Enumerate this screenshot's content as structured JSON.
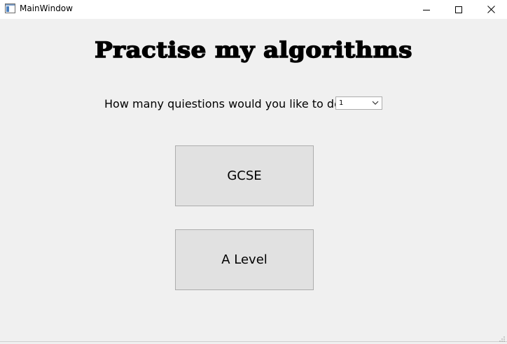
{
  "window": {
    "title": "MainWindow",
    "icons": {
      "app": "app-window-icon",
      "minimize": "minimize-icon",
      "maximize": "maximize-icon",
      "close": "close-icon"
    }
  },
  "main": {
    "heading": "Practise my algorithms",
    "question_label": "How many quiestions would you like to do?",
    "question_count": {
      "selected": "1",
      "dropdown_icon": "chevron-down-icon"
    },
    "buttons": {
      "gcse": "GCSE",
      "a_level": "A Level"
    }
  },
  "colors": {
    "window_bg": "#f0f0f0",
    "titlebar_bg": "#ffffff",
    "button_bg": "#e1e1e1",
    "button_border": "#adadad"
  }
}
